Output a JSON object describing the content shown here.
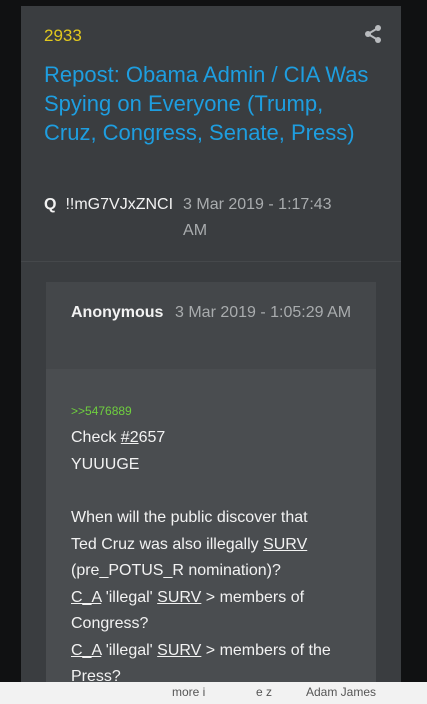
{
  "post": {
    "number": "2933",
    "title": "Repost: Obama Admin / CIA Was Spying on Everyone (Trump, Cruz, Congress, Senate, Press)",
    "author": "Q",
    "tripcode": "!!mG7VJxZNCI",
    "date": "3 Mar 2019 - 1:17:43 AM",
    "share_icon": "share-icon"
  },
  "quote": {
    "author": "Anonymous",
    "date": "3 Mar 2019 - 1:05:29 AM",
    "reply_link": ">>5476889",
    "lines": {
      "l1_pre": "Check ",
      "l1_link": "#2",
      "l1_post": "657",
      "l2": "YUUUGE",
      "l3": "When will the public discover that",
      "l4_pre": "Ted Cruz was also illegally ",
      "l4_u": "SURV",
      "l5": "(pre_POTUS_R nomination)?",
      "l6_u1": "C_A",
      "l6_mid": " 'illegal' ",
      "l6_u2": "SURV",
      "l6_post": " > members of",
      "l7": "Congress?",
      "l8_u1": "C_A",
      "l8_mid": " 'illegal' ",
      "l8_u2": "SURV",
      "l8_post": " > members of the",
      "l9": "Press?"
    }
  },
  "bottom": {
    "text_left": "more i",
    "text_mid": "e z",
    "text_right": "Adam James"
  },
  "colors": {
    "post_number": "#e1c81e",
    "title": "#1e9ee0",
    "reply_link": "#6fcf3f",
    "card_bg": "#3a3d40",
    "quote_bg": "#4a4d50"
  }
}
